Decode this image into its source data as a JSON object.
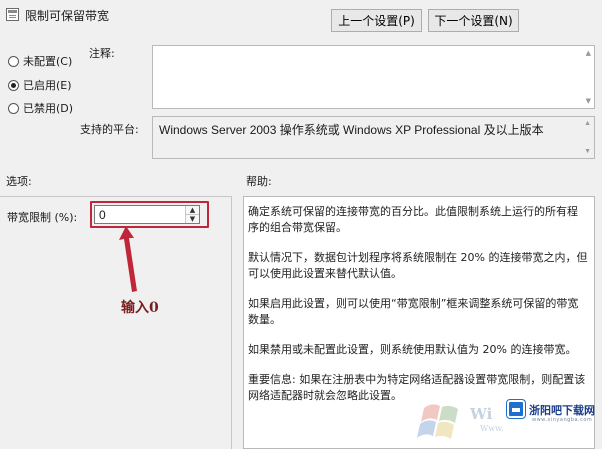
{
  "window": {
    "title": "限制可保留带宽"
  },
  "nav": {
    "prev_label": "上一个设置(P)",
    "next_label": "下一个设置(N)"
  },
  "state": {
    "options": [
      {
        "label": "未配置(C)",
        "checked": false
      },
      {
        "label": "已启用(E)",
        "checked": true
      },
      {
        "label": "已禁用(D)",
        "checked": false
      }
    ]
  },
  "comment": {
    "label": "注释:",
    "value": ""
  },
  "platform": {
    "label": "支持的平台:",
    "value": "Windows Server 2003 操作系统或 Windows XP Professional 及以上版本"
  },
  "sections": {
    "options_label": "选项:",
    "help_label": "帮助:"
  },
  "bandwidth": {
    "label": "带宽限制 (%):",
    "value": "0"
  },
  "annotation": {
    "text": "输入0",
    "color": "#c0263a"
  },
  "help": {
    "paragraphs": [
      "确定系统可保留的连接带宽的百分比。此值限制系统上运行的所有程序的组合带宽保留。",
      "默认情况下，数据包计划程序将系统限制在 20% 的连接带宽之内，但可以使用此设置来替代默认值。",
      "如果启用此设置，则可以使用“带宽限制”框来调整系统可保留的带宽数量。",
      "如果禁用或未配置此设置，则系统使用默认值为 20% 的连接带宽。",
      "重要信息: 如果在注册表中为特定网络适配器设置带宽限制，则配置该网络适配器时就会忽略此设置。"
    ]
  },
  "watermark": {
    "brand": "浙阳吧下载网",
    "url": "www.xinyangba.com",
    "wi": "Wi",
    "www": "Www."
  }
}
